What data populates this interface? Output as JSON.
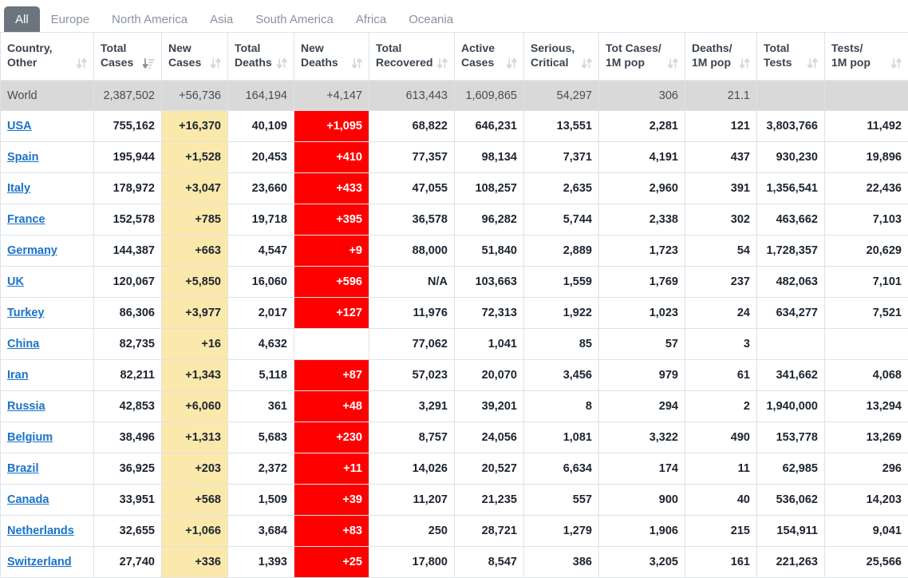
{
  "tabs": [
    {
      "label": "All",
      "active": true
    },
    {
      "label": "Europe",
      "active": false
    },
    {
      "label": "North America",
      "active": false
    },
    {
      "label": "Asia",
      "active": false
    },
    {
      "label": "South America",
      "active": false
    },
    {
      "label": "Africa",
      "active": false
    },
    {
      "label": "Oceania",
      "active": false
    }
  ],
  "table": {
    "columns": [
      {
        "label": "Country,\nOther",
        "sort": "both",
        "align": "left",
        "width": 117
      },
      {
        "label": "Total\nCases",
        "sort": "desc",
        "align": "right",
        "width": 85
      },
      {
        "label": "New\nCases",
        "sort": "both",
        "align": "right",
        "width": 83
      },
      {
        "label": "Total\nDeaths",
        "sort": "both",
        "align": "right",
        "width": 83
      },
      {
        "label": "New\nDeaths",
        "sort": "both",
        "align": "right",
        "width": 94
      },
      {
        "label": "Total\nRecovered",
        "sort": "both",
        "align": "right",
        "width": 107
      },
      {
        "label": "Active\nCases",
        "sort": "both",
        "align": "right",
        "width": 87
      },
      {
        "label": "Serious,\nCritical",
        "sort": "both",
        "align": "right",
        "width": 94
      },
      {
        "label": "Tot Cases/\n1M pop",
        "sort": "both",
        "align": "right",
        "width": 108
      },
      {
        "label": "Deaths/\n1M pop",
        "sort": "both",
        "align": "right",
        "width": 90
      },
      {
        "label": "Total\nTests",
        "sort": "both",
        "align": "right",
        "width": 85
      },
      {
        "label": "Tests/\n1M pop",
        "sort": "both",
        "align": "right",
        "width": 105
      }
    ],
    "world_row": {
      "country": "World",
      "total_cases": "2,387,502",
      "new_cases": "+56,736",
      "total_deaths": "164,194",
      "new_deaths": "+4,147",
      "total_recovered": "613,443",
      "active_cases": "1,609,865",
      "serious_critical": "54,297",
      "tot_cases_1m": "306",
      "deaths_1m": "21.1",
      "total_tests": "",
      "tests_1m": ""
    },
    "rows": [
      {
        "country": "USA",
        "total_cases": "755,162",
        "new_cases": "+16,370",
        "total_deaths": "40,109",
        "new_deaths": "+1,095",
        "total_recovered": "68,822",
        "active_cases": "646,231",
        "serious_critical": "13,551",
        "tot_cases_1m": "2,281",
        "deaths_1m": "121",
        "total_tests": "3,803,766",
        "tests_1m": "11,492"
      },
      {
        "country": "Spain",
        "total_cases": "195,944",
        "new_cases": "+1,528",
        "total_deaths": "20,453",
        "new_deaths": "+410",
        "total_recovered": "77,357",
        "active_cases": "98,134",
        "serious_critical": "7,371",
        "tot_cases_1m": "4,191",
        "deaths_1m": "437",
        "total_tests": "930,230",
        "tests_1m": "19,896"
      },
      {
        "country": "Italy",
        "total_cases": "178,972",
        "new_cases": "+3,047",
        "total_deaths": "23,660",
        "new_deaths": "+433",
        "total_recovered": "47,055",
        "active_cases": "108,257",
        "serious_critical": "2,635",
        "tot_cases_1m": "2,960",
        "deaths_1m": "391",
        "total_tests": "1,356,541",
        "tests_1m": "22,436"
      },
      {
        "country": "France",
        "total_cases": "152,578",
        "new_cases": "+785",
        "total_deaths": "19,718",
        "new_deaths": "+395",
        "total_recovered": "36,578",
        "active_cases": "96,282",
        "serious_critical": "5,744",
        "tot_cases_1m": "2,338",
        "deaths_1m": "302",
        "total_tests": "463,662",
        "tests_1m": "7,103"
      },
      {
        "country": "Germany",
        "total_cases": "144,387",
        "new_cases": "+663",
        "total_deaths": "4,547",
        "new_deaths": "+9",
        "total_recovered": "88,000",
        "active_cases": "51,840",
        "serious_critical": "2,889",
        "tot_cases_1m": "1,723",
        "deaths_1m": "54",
        "total_tests": "1,728,357",
        "tests_1m": "20,629"
      },
      {
        "country": "UK",
        "total_cases": "120,067",
        "new_cases": "+5,850",
        "total_deaths": "16,060",
        "new_deaths": "+596",
        "total_recovered": "N/A",
        "active_cases": "103,663",
        "serious_critical": "1,559",
        "tot_cases_1m": "1,769",
        "deaths_1m": "237",
        "total_tests": "482,063",
        "tests_1m": "7,101"
      },
      {
        "country": "Turkey",
        "total_cases": "86,306",
        "new_cases": "+3,977",
        "total_deaths": "2,017",
        "new_deaths": "+127",
        "total_recovered": "11,976",
        "active_cases": "72,313",
        "serious_critical": "1,922",
        "tot_cases_1m": "1,023",
        "deaths_1m": "24",
        "total_tests": "634,277",
        "tests_1m": "7,521"
      },
      {
        "country": "China",
        "total_cases": "82,735",
        "new_cases": "+16",
        "total_deaths": "4,632",
        "new_deaths": "",
        "total_recovered": "77,062",
        "active_cases": "1,041",
        "serious_critical": "85",
        "tot_cases_1m": "57",
        "deaths_1m": "3",
        "total_tests": "",
        "tests_1m": ""
      },
      {
        "country": "Iran",
        "total_cases": "82,211",
        "new_cases": "+1,343",
        "total_deaths": "5,118",
        "new_deaths": "+87",
        "total_recovered": "57,023",
        "active_cases": "20,070",
        "serious_critical": "3,456",
        "tot_cases_1m": "979",
        "deaths_1m": "61",
        "total_tests": "341,662",
        "tests_1m": "4,068"
      },
      {
        "country": "Russia",
        "total_cases": "42,853",
        "new_cases": "+6,060",
        "total_deaths": "361",
        "new_deaths": "+48",
        "total_recovered": "3,291",
        "active_cases": "39,201",
        "serious_critical": "8",
        "tot_cases_1m": "294",
        "deaths_1m": "2",
        "total_tests": "1,940,000",
        "tests_1m": "13,294"
      },
      {
        "country": "Belgium",
        "total_cases": "38,496",
        "new_cases": "+1,313",
        "total_deaths": "5,683",
        "new_deaths": "+230",
        "total_recovered": "8,757",
        "active_cases": "24,056",
        "serious_critical": "1,081",
        "tot_cases_1m": "3,322",
        "deaths_1m": "490",
        "total_tests": "153,778",
        "tests_1m": "13,269"
      },
      {
        "country": "Brazil",
        "total_cases": "36,925",
        "new_cases": "+203",
        "total_deaths": "2,372",
        "new_deaths": "+11",
        "total_recovered": "14,026",
        "active_cases": "20,527",
        "serious_critical": "6,634",
        "tot_cases_1m": "174",
        "deaths_1m": "11",
        "total_tests": "62,985",
        "tests_1m": "296"
      },
      {
        "country": "Canada",
        "total_cases": "33,951",
        "new_cases": "+568",
        "total_deaths": "1,509",
        "new_deaths": "+39",
        "total_recovered": "11,207",
        "active_cases": "21,235",
        "serious_critical": "557",
        "tot_cases_1m": "900",
        "deaths_1m": "40",
        "total_tests": "536,062",
        "tests_1m": "14,203"
      },
      {
        "country": "Netherlands",
        "total_cases": "32,655",
        "new_cases": "+1,066",
        "total_deaths": "3,684",
        "new_deaths": "+83",
        "total_recovered": "250",
        "active_cases": "28,721",
        "serious_critical": "1,279",
        "tot_cases_1m": "1,906",
        "deaths_1m": "215",
        "total_tests": "154,911",
        "tests_1m": "9,041"
      },
      {
        "country": "Switzerland",
        "total_cases": "27,740",
        "new_cases": "+336",
        "total_deaths": "1,393",
        "new_deaths": "+25",
        "total_recovered": "17,800",
        "active_cases": "8,547",
        "serious_critical": "386",
        "tot_cases_1m": "3,205",
        "deaths_1m": "161",
        "total_tests": "221,263",
        "tests_1m": "25,566"
      }
    ]
  },
  "colors": {
    "tab_active_bg": "#6c757d",
    "tab_inactive_text": "#8a92a0",
    "new_cases_bg": "#fbe9ab",
    "new_deaths_bg": "#ff0000",
    "world_row_bg": "#d9d9d9",
    "link": "#1a73c8",
    "border": "#dee2e6"
  }
}
